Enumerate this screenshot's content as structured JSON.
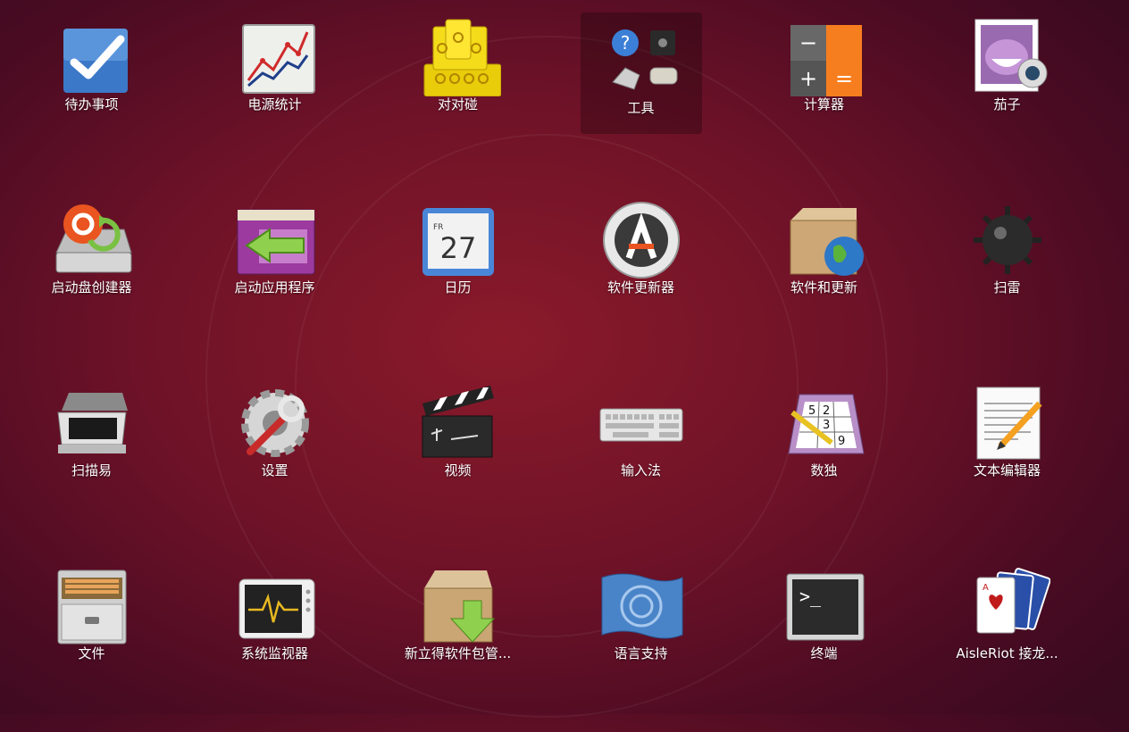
{
  "apps": [
    {
      "label": "待办事项",
      "icon": "todo-check-icon"
    },
    {
      "label": "电源统计",
      "icon": "power-statistics-icon"
    },
    {
      "label": "对对碰",
      "icon": "swell-foop-icon"
    },
    {
      "label": "工具",
      "icon": "utilities-folder-icon",
      "folder": true
    },
    {
      "label": "计算器",
      "icon": "calculator-icon"
    },
    {
      "label": "茄子",
      "icon": "cheese-webcam-icon"
    },
    {
      "label": "启动盘创建器",
      "icon": "startup-disk-creator-icon"
    },
    {
      "label": "启动应用程序",
      "icon": "startup-applications-icon"
    },
    {
      "label": "日历",
      "icon": "calendar-icon"
    },
    {
      "label": "软件更新器",
      "icon": "software-updater-icon"
    },
    {
      "label": "软件和更新",
      "icon": "software-properties-icon"
    },
    {
      "label": "扫雷",
      "icon": "mines-icon"
    },
    {
      "label": "扫描易",
      "icon": "scanner-icon"
    },
    {
      "label": "设置",
      "icon": "settings-gear-wrench-icon"
    },
    {
      "label": "视频",
      "icon": "video-clapperboard-icon"
    },
    {
      "label": "输入法",
      "icon": "keyboard-icon"
    },
    {
      "label": "数独",
      "icon": "sudoku-icon"
    },
    {
      "label": "文本编辑器",
      "icon": "text-editor-icon"
    },
    {
      "label": "文件",
      "icon": "files-cabinet-icon"
    },
    {
      "label": "系统监视器",
      "icon": "system-monitor-icon"
    },
    {
      "label": "新立得软件包管...",
      "icon": "synaptic-package-icon"
    },
    {
      "label": "语言支持",
      "icon": "language-support-flag-icon"
    },
    {
      "label": "终端",
      "icon": "terminal-icon"
    },
    {
      "label": "AisleRiot 接龙...",
      "icon": "aisleriot-cards-icon"
    }
  ],
  "calendar": {
    "day": "27",
    "weekday": "FR"
  },
  "sudoku": {
    "n1": "5",
    "n2": "2",
    "n3": "3",
    "n4": "9"
  },
  "terminal": {
    "prompt": ">_"
  },
  "calculator": {
    "minus": "−",
    "plus": "+",
    "equals": "="
  },
  "colors": {
    "accent": "#e95420",
    "background": "#6e1228",
    "calc_orange": "#f77e1f"
  }
}
